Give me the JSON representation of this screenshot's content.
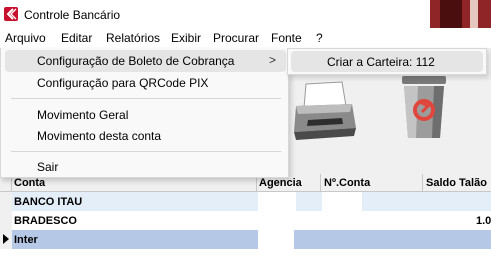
{
  "window": {
    "title": "Controle Bancário",
    "app_icon": "bank-logo-icon"
  },
  "menubar": {
    "items": [
      "Arquivo",
      "Editar",
      "Relatórios",
      "Exibir",
      "Procurar",
      "Fonte",
      "?"
    ]
  },
  "dropdown": {
    "items": [
      {
        "label": "Configuração de Boleto de Cobrança",
        "has_submenu": true,
        "highlighted": true
      },
      {
        "label": "Configuração para QRCode PIX"
      },
      {
        "label": "Movimento Geral"
      },
      {
        "label": "Movimento desta conta"
      },
      {
        "label": "Sair"
      }
    ],
    "submenu_arrow": ">"
  },
  "submenu": {
    "items": [
      {
        "label": "Criar a Carteira: 112"
      }
    ]
  },
  "toolbar": {
    "icons": [
      "printer-icon",
      "trash-icon"
    ]
  },
  "grid": {
    "columns": [
      "Conta",
      "Agencia",
      "Nº.Conta",
      "Saldo Talão"
    ],
    "rows": [
      {
        "conta": "BANCO ITAU",
        "agencia": "",
        "numero": "",
        "saldo": ""
      },
      {
        "conta": "BRADESCO",
        "agencia": "",
        "numero": "",
        "saldo": "1.0"
      },
      {
        "conta": "Inter",
        "agencia": "",
        "numero": "",
        "saldo": "",
        "selected": true
      }
    ]
  },
  "colors": {
    "selected_row": "#b5c9e6",
    "menu_highlight": "#e5e5e5",
    "app_icon": "#c8102e"
  }
}
